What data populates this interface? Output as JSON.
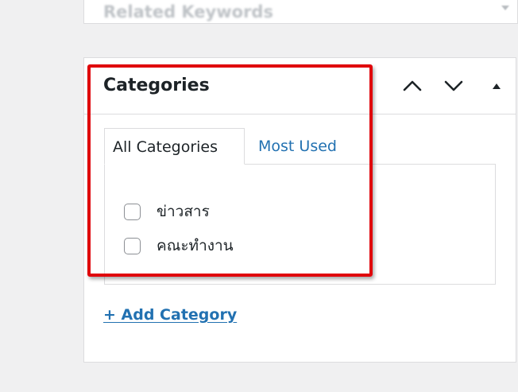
{
  "previous_panel": {
    "title": "Related Keywords"
  },
  "categories_box": {
    "title": "Categories",
    "controls": {
      "move_up": "chevron-up-icon",
      "move_down": "chevron-down-icon",
      "toggle": "triangle-up-icon"
    },
    "tabs": [
      {
        "label": "All Categories",
        "active": true
      },
      {
        "label": "Most Used",
        "active": false
      }
    ],
    "items": [
      {
        "label": "ข่าวสาร",
        "checked": false
      },
      {
        "label": "คณะทำงาน",
        "checked": false
      }
    ],
    "add_link": "+ Add Category"
  },
  "colors": {
    "link": "#2271b1",
    "highlight": "#e0040b",
    "border": "#dcdcde",
    "background": "#f0f0f1"
  }
}
